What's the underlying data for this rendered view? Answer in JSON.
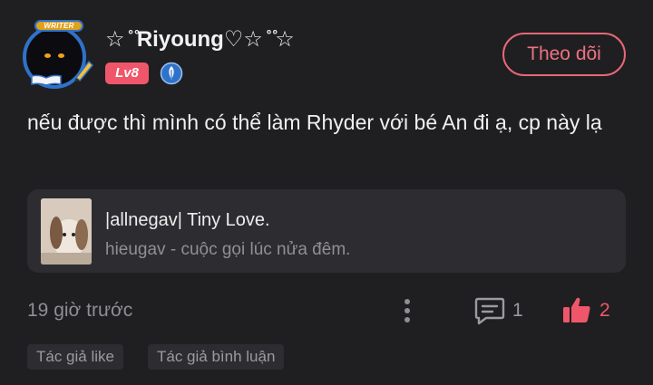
{
  "comment": {
    "author": {
      "name": "☆ ̊ ̊Riyoung♡☆ ̊ ̊☆",
      "writer_badge": "WRITER",
      "level": "Lv8"
    },
    "follow_label": "Theo dõi",
    "text": "nếu được thì mình có thể làm Rhyder với bé An đi ạ, cp này lạ",
    "story": {
      "title": "|allnegav| Tiny Love.",
      "subtitle": "hieugav - cuộc gọi lúc nửa đêm."
    },
    "timestamp": "19 giờ trước",
    "reply_count": "1",
    "like_count": "2",
    "tags": [
      "Tác giả like",
      "Tác giả bình luận"
    ]
  },
  "colors": {
    "background": "#1f1f21",
    "accent": "#f0566a",
    "avatar_ring": "#2f72c9",
    "card": "#2d2d31"
  },
  "icons": [
    "pen-icon",
    "book-icon",
    "quill-badge-icon",
    "more-vertical-icon",
    "comment-icon",
    "thumbs-up-icon"
  ]
}
